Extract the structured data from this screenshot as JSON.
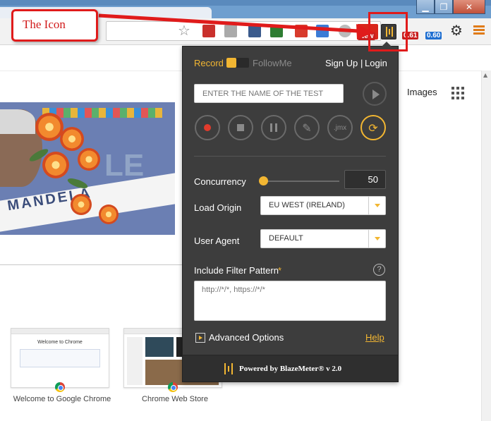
{
  "annotation": {
    "callout_text": "The Icon",
    "color": "#e01b1b"
  },
  "browser": {
    "window_controls": {
      "minimize": "▁",
      "maximize": "❐",
      "close": "✕"
    },
    "toolbar": {
      "star_icon": "☆",
      "badge_new": "New",
      "badge_061": "0.61",
      "badge_060": "0.60",
      "gear_icon": "⚙"
    }
  },
  "page": {
    "images_link": "Images",
    "doodle_text": "MANDELA",
    "doodle_letters": "LE",
    "thumbnails": [
      {
        "title": "Welcome to Chrome",
        "caption": "Welcome to Google Chrome"
      },
      {
        "caption": "Chrome Web Store"
      }
    ]
  },
  "popup": {
    "mode": {
      "record_label": "Record",
      "follow_label": "FollowMe",
      "record_active": true
    },
    "auth": {
      "signup": "Sign Up",
      "separator": "|",
      "login": "Login"
    },
    "test_name": {
      "placeholder": "ENTER THE NAME OF THE TEST",
      "value": ""
    },
    "actions": {
      "record": "record",
      "stop": "stop",
      "pause": "pause",
      "edit_icon": "✎",
      "jmx_label": ".jmx",
      "loop_icon": "⟳"
    },
    "concurrency": {
      "label": "Concurrency",
      "value": "50"
    },
    "load_origin": {
      "label": "Load Origin",
      "selected": "EU WEST (IRELAND)"
    },
    "user_agent": {
      "label": "User Agent",
      "selected": "DEFAULT"
    },
    "filter": {
      "label": "Include Filter Pattern",
      "required_mark": "*",
      "help_icon": "?",
      "placeholder": "http://*/*, https://*/*"
    },
    "advanced": {
      "label": "Advanced Options",
      "help_link": "Help"
    },
    "footer": {
      "text": "Powered by BlazeMeter® v 2.0"
    },
    "colors": {
      "accent": "#f2b632",
      "panel": "#3d3d3d",
      "record_red": "#e23b2c"
    }
  }
}
